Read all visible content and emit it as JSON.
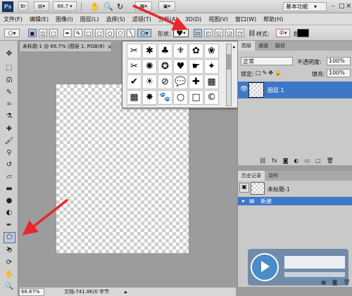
{
  "app": {
    "logo": "Ps",
    "zoom_value": "66.7",
    "workspace_label": "基本功能"
  },
  "menu": [
    "文件(F)",
    "编辑(E)",
    "图像(I)",
    "图层(L)",
    "选择(S)",
    "滤镜(T)",
    "分析(A)",
    "3D(D)",
    "视图(V)",
    "窗口(W)",
    "帮助(H)"
  ],
  "options": {
    "shape_label": "形状:",
    "style_label": "样式:",
    "color_label": "颜色:",
    "color_value": "#000000"
  },
  "document": {
    "tab_title": "未标题-1 @ 66.7% (图层 1, RGB/8)",
    "close_glyph": "×",
    "zoom_status": "66.67%",
    "doc_info": "文档:741.8K/0 字节"
  },
  "shape_picker": {
    "shapes": [
      "✂",
      "✱",
      "♣",
      "⚜",
      "✿",
      "❀",
      "✂",
      "✺",
      "✪",
      "♥",
      "☛",
      "✦",
      "✔",
      "☀",
      "⊘",
      "💬",
      "✚",
      "▦",
      "▦",
      "✸",
      "🐾",
      "○",
      "□",
      "©",
      "®",
      "™"
    ]
  },
  "layers_panel": {
    "tabs": [
      "图层",
      "通道",
      "路径"
    ],
    "blend_mode": "正常",
    "opacity_label": "不透明度:",
    "opacity_value": "100%",
    "lock_label": "锁定:",
    "fill_label": "填充:",
    "fill_value": "100%",
    "layer_name": "图层 1"
  },
  "history_panel": {
    "tabs": [
      "历史记录",
      "动作"
    ],
    "snapshot_name": "未标题-1",
    "step_name": "新建"
  },
  "colors": {
    "selection": "#3c78c7",
    "annotation_arrow": "#e8262b"
  }
}
